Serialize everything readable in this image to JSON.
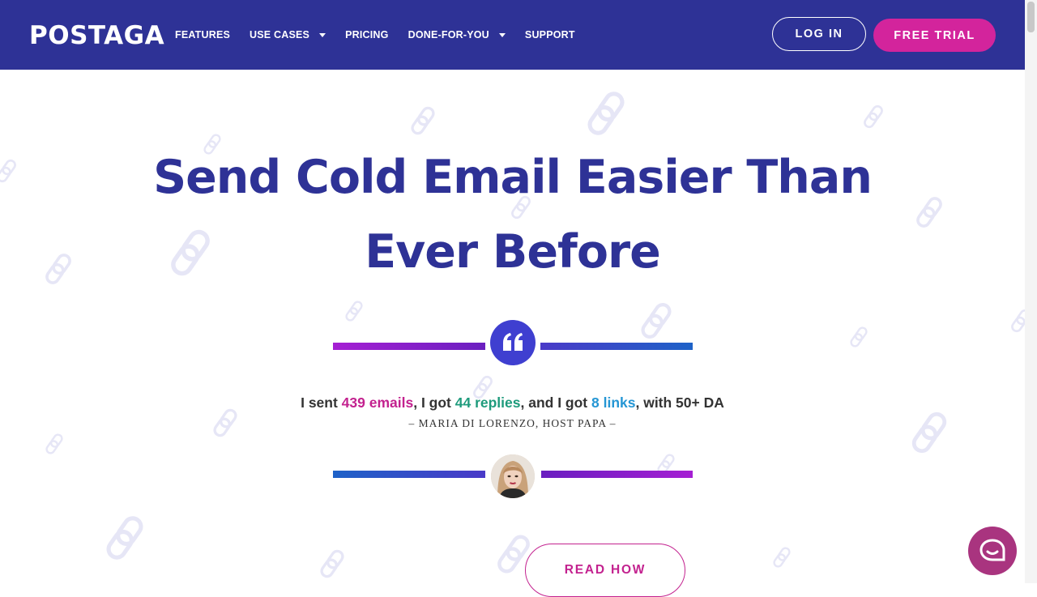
{
  "header": {
    "logo": "POSTAGA",
    "nav": [
      {
        "label": "FEATURES",
        "dropdown": false
      },
      {
        "label": "USE CASES",
        "dropdown": true
      },
      {
        "label": "PRICING",
        "dropdown": false
      },
      {
        "label": "DONE-FOR-YOU",
        "dropdown": true
      },
      {
        "label": "SUPPORT",
        "dropdown": false
      }
    ],
    "login_label": "LOG IN",
    "trial_label": "FREE TRIAL"
  },
  "hero": {
    "headline": "Send Cold Email Easier Than Ever Before"
  },
  "testimonial": {
    "part1": "I sent ",
    "emails": "439 emails",
    "part2": ", I got ",
    "replies": "44 replies",
    "part3": ", and I got ",
    "links": "8 links",
    "part4": ", with 50+ DA",
    "author": "– MARIA DI LORENZO, HOST PAPA –",
    "quote_icon": "quote-icon"
  },
  "cta": {
    "read_label": "READ HOW"
  },
  "chat": {
    "icon": "chat-bubble-icon"
  },
  "colors": {
    "header_bg": "#2e3296",
    "accent_pink": "#d3249c",
    "headline": "#2e3296",
    "quote_circle": "#3f3fd0",
    "highlight_green": "#1e9b7c",
    "highlight_blue": "#2596d4"
  }
}
